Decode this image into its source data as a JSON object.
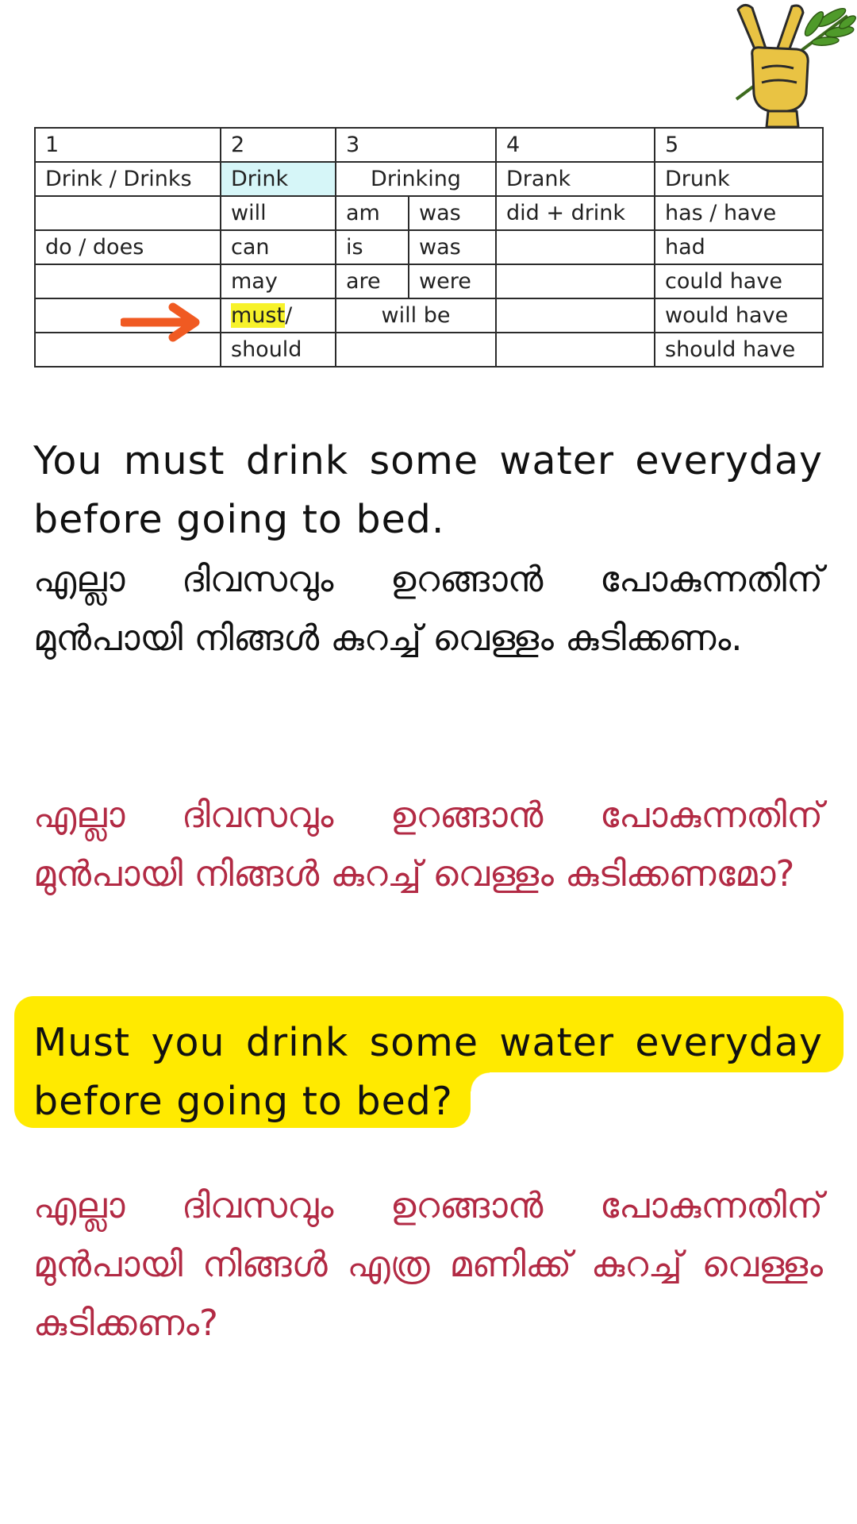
{
  "table": {
    "header": [
      "1",
      "2",
      "3",
      "4",
      "5"
    ],
    "row1": [
      "Drink / Drinks",
      "Drink",
      "Drinking",
      "Drank",
      "Drunk"
    ],
    "row2": [
      "",
      "will",
      "am",
      "was",
      "did + drink",
      "has / have"
    ],
    "row3": [
      "do / does",
      "can",
      "is",
      "was",
      "",
      "had"
    ],
    "row4": [
      "",
      "may",
      "are",
      "were",
      "",
      "could have"
    ],
    "row5": [
      "",
      "must",
      "/",
      "will be",
      "",
      "would have"
    ],
    "row6": [
      "",
      "should",
      "",
      "",
      "should have"
    ]
  },
  "colors": {
    "red_text": "#b22a44",
    "bubble_yellow": "#ffea00",
    "arrow_orange": "#f05a22",
    "cell_blue": "#d6f6f8",
    "highlight_yellow": "#f7f22a"
  },
  "icons": [
    "peace-hand-icon",
    "arrow-right-icon"
  ],
  "text": {
    "en1": "You must drink some water everyday before going to bed.",
    "ml1": "എല്ലാ ദിവസവും ഉറങ്ങാൻ പോകുന്നതിന് മുൻപായി നിങ്ങൾ കുറച്ച് വെള്ളം കുടിക്കണം.",
    "ml2": "എല്ലാ ദിവസവും ഉറങ്ങാൻ പോകുന്നതിന് മുൻപായി നിങ്ങൾ കുറച്ച് വെള്ളം കുടിക്കണമോ?",
    "en2": "Must you drink some water everyday before going to bed?",
    "ml3": "എല്ലാ ദിവസവും ഉറങ്ങാൻ പോകുന്നതിന് മുൻപായി നിങ്ങൾ എത്ര മണിക്ക് കുറച്ച് വെള്ളം കുടിക്കണം?"
  }
}
